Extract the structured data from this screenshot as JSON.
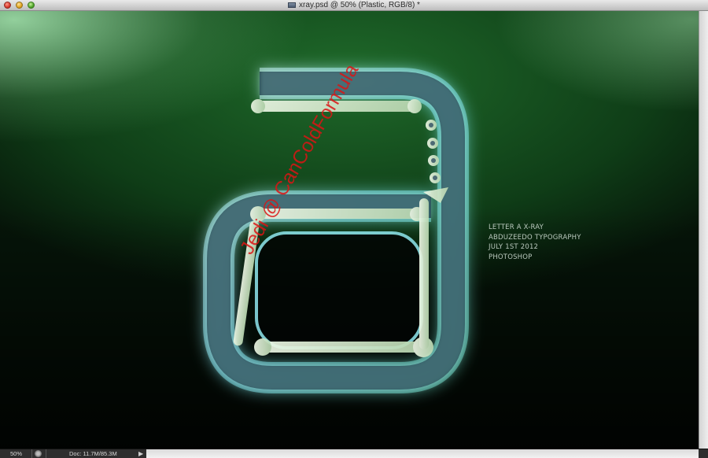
{
  "window": {
    "title": "xray.psd @ 50% (Plastic, RGB/8) *"
  },
  "canvas": {
    "caption_lines": [
      "LETTER A X-RAY",
      "ABDUZEEDO TYPOGRAPHY",
      "JULY 1ST 2012",
      "PHOTOSHOP"
    ],
    "watermark": "Jedi @ CanColdFormula"
  },
  "statusbar": {
    "zoom": "50%",
    "doc_info": "Doc: 11.7M/85.3M",
    "menu_arrow": "▶"
  },
  "icons": {
    "document": "document-icon",
    "status": "status-circle-icon",
    "arrow": "triangle-right-icon"
  },
  "colors": {
    "canvas_green": "#0f3d17",
    "glass_cyan": "#a8f0ff",
    "statusbar_bg": "#2e2e2e",
    "watermark_red": "#dc1414"
  }
}
